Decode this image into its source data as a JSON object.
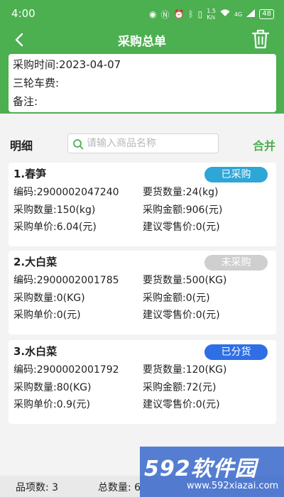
{
  "status_bar": {
    "time": "4:00",
    "net_speed_top": "1.5",
    "net_speed_bottom": "K/s",
    "signal_label": "4G",
    "battery": "48"
  },
  "header": {
    "title": "采购总单",
    "back_icon": "back-arrow-icon",
    "delete_icon": "trash-icon"
  },
  "info": {
    "purchase_time": "采购时间:2023-04-07",
    "tricycle_fee": "三轮车费:",
    "remark": "备注:"
  },
  "detail": {
    "title": "明细",
    "search_placeholder": "请输入商品名称",
    "merge_label": "合并"
  },
  "items": [
    {
      "name": "1.春笋",
      "status": "已采购",
      "status_color": "#2ea6d6",
      "code": "编码:2900002047240",
      "order_qty": "要货数量:24(kg)",
      "purchase_qty": "采购数量:150(kg)",
      "purchase_amount": "采购金额:906(元)",
      "unit_price": "采购单价:6.04(元)",
      "retail_price": "建议零售价:0(元)"
    },
    {
      "name": "2.大白菜",
      "status": "未采购",
      "status_color": "#cfcfcf",
      "code": "编码:2900002001785",
      "order_qty": "要货数量:500(KG)",
      "purchase_qty": "采购数量:0(KG)",
      "purchase_amount": "采购金额:0(元)",
      "unit_price": "采购单价:0(元)",
      "retail_price": "建议零售价:0(元)"
    },
    {
      "name": "3.水白菜",
      "status": "已分货",
      "status_color": "#2f6fe6",
      "code": "编码:2900002001792",
      "order_qty": "要货数量:120(KG)",
      "purchase_qty": "采购数量:80(KG)",
      "purchase_amount": "采购金额:72(元)",
      "unit_price": "采购单价:0.9(元)",
      "retail_price": "建议零售价:0(元)"
    }
  ],
  "footer": {
    "item_count": "品项数:  3",
    "total_qty": "总数量:  6"
  },
  "watermark": {
    "big": "592软件园",
    "small": "www.592xiazai.com"
  },
  "colors": {
    "brand_green": "#4caf50",
    "background": "#f3f3f3"
  }
}
